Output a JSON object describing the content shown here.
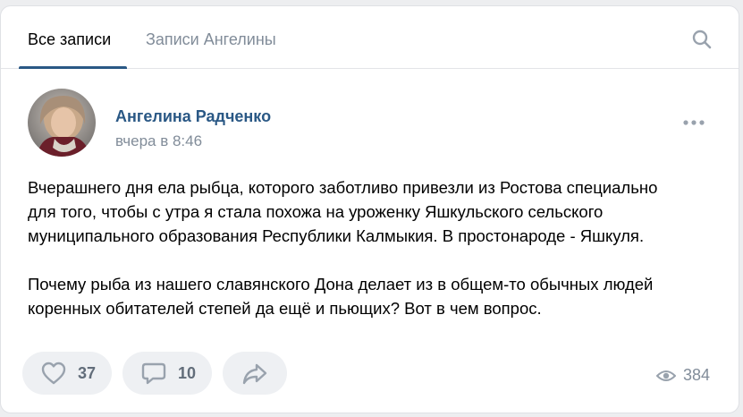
{
  "tabs": {
    "all_label": "Все записи",
    "user_label": "Записи Ангелины",
    "active": "all"
  },
  "icons": {
    "search": "search-icon",
    "more": "more-horizontal-icon",
    "like": "heart-icon",
    "comment": "comment-icon",
    "share": "share-icon",
    "views": "eye-icon"
  },
  "colors": {
    "accent": "#2a5885",
    "secondary_text": "#818c99",
    "action_bg": "#eef0f3",
    "icon": "#99a2ad"
  },
  "post": {
    "author": "Ангелина Радченко",
    "time": "вчера в 8:46",
    "paragraph1_lines": [
      "Вчерашнего дня ела рыбца, которого заботливо привезли из Ростова специально",
      "для того, чтобы с утра я стала похожа на уроженку Яшкульского сельского",
      "муниципального образования Республики Калмыкия. В простонароде - Яшкуля."
    ],
    "paragraph2_lines": [
      "Почему рыба из нашего славянского Дона делает из в общем-то обычных людей",
      "коренных обитателей степей да ещё и пьющих? Вот в чем вопрос."
    ],
    "likes": "37",
    "comments": "10",
    "views": "384"
  }
}
